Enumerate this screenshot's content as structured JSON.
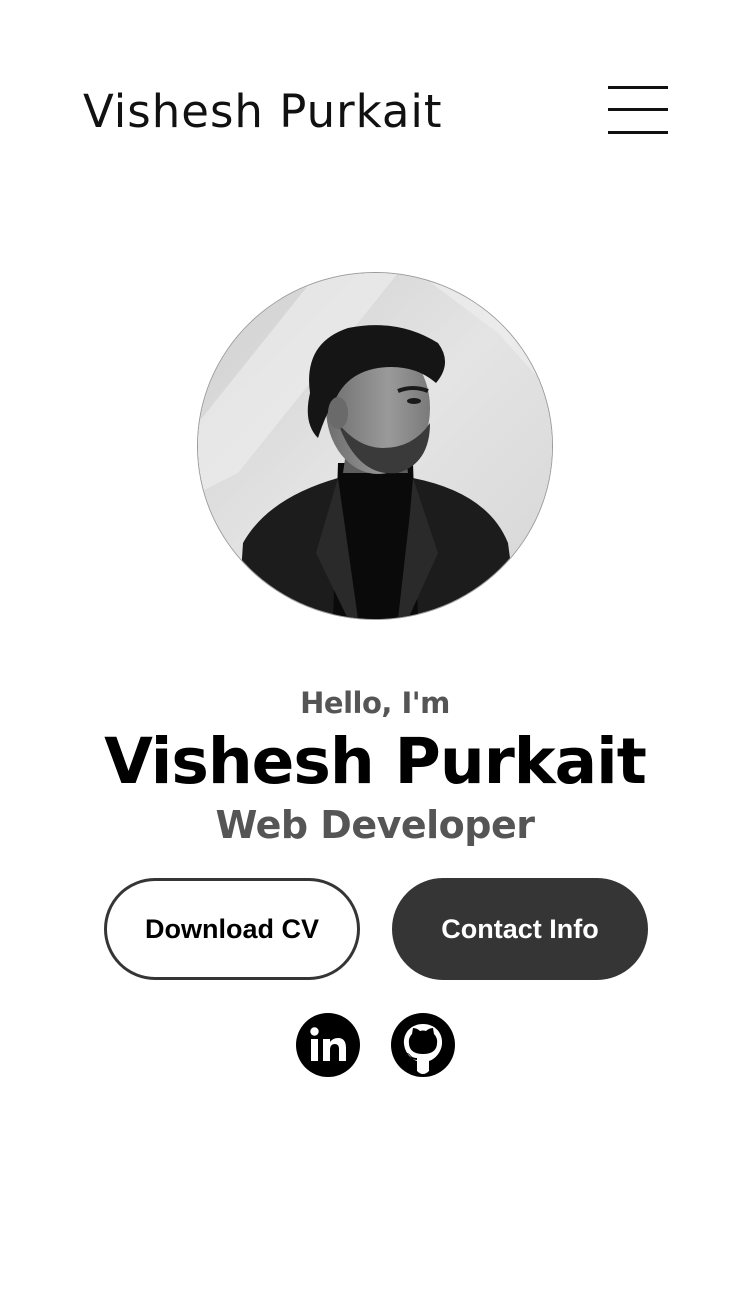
{
  "nav": {
    "logo": "Vishesh Purkait",
    "menu_icon": "hamburger-icon"
  },
  "hero": {
    "greeting": "Hello, I'm",
    "name": "Vishesh Purkait",
    "role": "Web Developer"
  },
  "buttons": {
    "download_cv": "Download CV",
    "contact_info": "Contact Info"
  },
  "socials": [
    {
      "icon": "linkedin-icon"
    },
    {
      "icon": "github-icon"
    }
  ],
  "colors": {
    "text": "#000000",
    "muted_text": "#555555",
    "button_dark": "#353535",
    "background": "#ffffff"
  }
}
